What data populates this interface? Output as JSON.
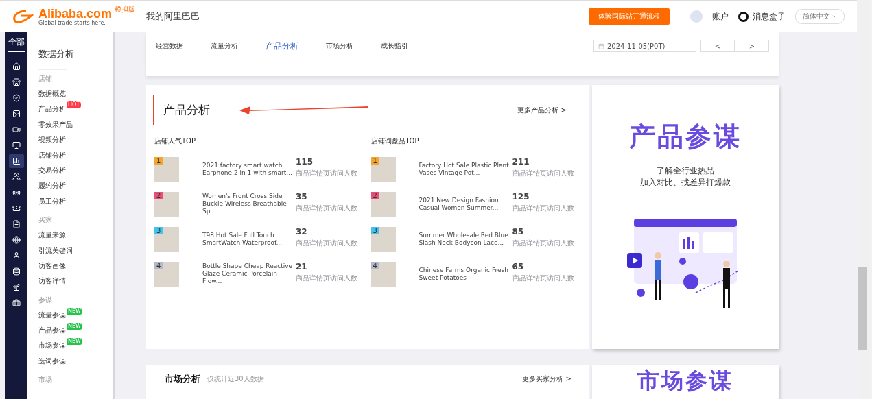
{
  "header": {
    "logo": "Alibaba.com",
    "logo_tagline": "Global trade starts here.",
    "logo_badge": "模拟版",
    "title": "我的阿里巴巴",
    "cta": "体验国际站开通流程",
    "account": "账户",
    "messages": "消息盒子",
    "language": "简体中文"
  },
  "rail": {
    "label": "全部",
    "icons": [
      {
        "kind": "home",
        "selected": false
      },
      {
        "kind": "store",
        "selected": false
      },
      {
        "kind": "shield",
        "selected": false
      },
      {
        "kind": "image",
        "selected": false
      },
      {
        "kind": "video",
        "selected": false
      },
      {
        "kind": "monitor",
        "selected": false
      },
      {
        "kind": "chart",
        "selected": true
      },
      {
        "kind": "users",
        "selected": false
      },
      {
        "kind": "radio",
        "selected": false
      },
      {
        "kind": "ticket",
        "selected": false
      },
      {
        "kind": "file",
        "selected": false
      },
      {
        "kind": "globe",
        "selected": false
      },
      {
        "kind": "user",
        "selected": false
      },
      {
        "kind": "database",
        "selected": false
      },
      {
        "kind": "sprout",
        "selected": false
      },
      {
        "kind": "briefcase",
        "selected": false
      }
    ]
  },
  "sidebar": {
    "title": "数据分析",
    "sections": [
      {
        "heading": "店铺",
        "items": [
          {
            "label": "数据概览"
          },
          {
            "label": "产品分析",
            "badge": "HOT"
          },
          {
            "label": "零效果产品"
          },
          {
            "label": "视频分析"
          },
          {
            "label": "店铺分析"
          },
          {
            "label": "交易分析"
          },
          {
            "label": "履约分析"
          },
          {
            "label": "员工分析"
          }
        ]
      },
      {
        "heading": "买家",
        "items": [
          {
            "label": "流量来源"
          },
          {
            "label": "引流关键词"
          },
          {
            "label": "访客画像"
          },
          {
            "label": "访客详情"
          }
        ]
      },
      {
        "heading": "参谋",
        "items": [
          {
            "label": "流量参谋",
            "badge": "NEW"
          },
          {
            "label": "产品参谋",
            "badge": "NEW"
          },
          {
            "label": "市场参谋",
            "badge": "NEW"
          },
          {
            "label": "选词参谋"
          }
        ]
      },
      {
        "heading": "市场"
      }
    ]
  },
  "nav": {
    "tabs": [
      {
        "label": "经营数据",
        "selected": false
      },
      {
        "label": "流量分析",
        "selected": false
      },
      {
        "label": "产品分析",
        "selected": true
      },
      {
        "label": "市场分析",
        "selected": false
      },
      {
        "label": "成长指引",
        "selected": false
      }
    ],
    "date": "2024-11-05(P0T)",
    "prev": "<",
    "next": ">"
  },
  "product_section": {
    "title": "产品分析",
    "more": "更多产品分析 >",
    "lists": [
      {
        "title": "店铺人气TOP",
        "items": [
          {
            "rank": "1",
            "color": "#f2a530",
            "name": "2021 factory smart watch Earphone 2 in 1 with smart...",
            "count": "115",
            "metric": "商品详情页访问人数"
          },
          {
            "rank": "2",
            "color": "#e8507a",
            "name": "Women's Front Cross Side Buckle Wireless Breathable Sp...",
            "count": "35",
            "metric": "商品详情页访问人数"
          },
          {
            "rank": "3",
            "color": "#45c3ea",
            "name": "T98 Hot Sale Full Touch SmartWatch Waterproof...",
            "count": "32",
            "metric": "商品详情页访问人数"
          },
          {
            "rank": "4",
            "color": "#b4b8c8",
            "name": "Bottle Shape Cheap Reactive Glaze Ceramic Porcelain Flow...",
            "count": "21",
            "metric": "商品详情页访问人数"
          }
        ]
      },
      {
        "title": "店铺询盘品TOP",
        "items": [
          {
            "rank": "1",
            "color": "#f2a530",
            "name": "Factory Hot Sale Plastic Plant Vases Vintage Pot...",
            "count": "211",
            "metric": "商品详情页访问人数"
          },
          {
            "rank": "2",
            "color": "#e8507a",
            "name": "2021 New Design Fashion Casual Women Summer...",
            "count": "125",
            "metric": "商品详情页访问人数"
          },
          {
            "rank": "3",
            "color": "#45c3ea",
            "name": "Summer Wholesale Red Blue Slash Neck Bodycon Lace...",
            "count": "85",
            "metric": "商品详情页访问人数"
          },
          {
            "rank": "4",
            "color": "#b4b8c8",
            "name": "Chinese Farms Organic Fresh Sweet Potatoes",
            "count": "65",
            "metric": "商品详情页访问人数"
          }
        ]
      }
    ]
  },
  "product_promo": {
    "title": "产品参谋",
    "lines": [
      "了解全行业热品",
      "加入对比、找差异打爆款"
    ]
  },
  "market_section": {
    "title": "市场分析",
    "note": "仅统计近30天数据",
    "more": "更多买家分析 >",
    "promo_title": "市场参谋"
  }
}
